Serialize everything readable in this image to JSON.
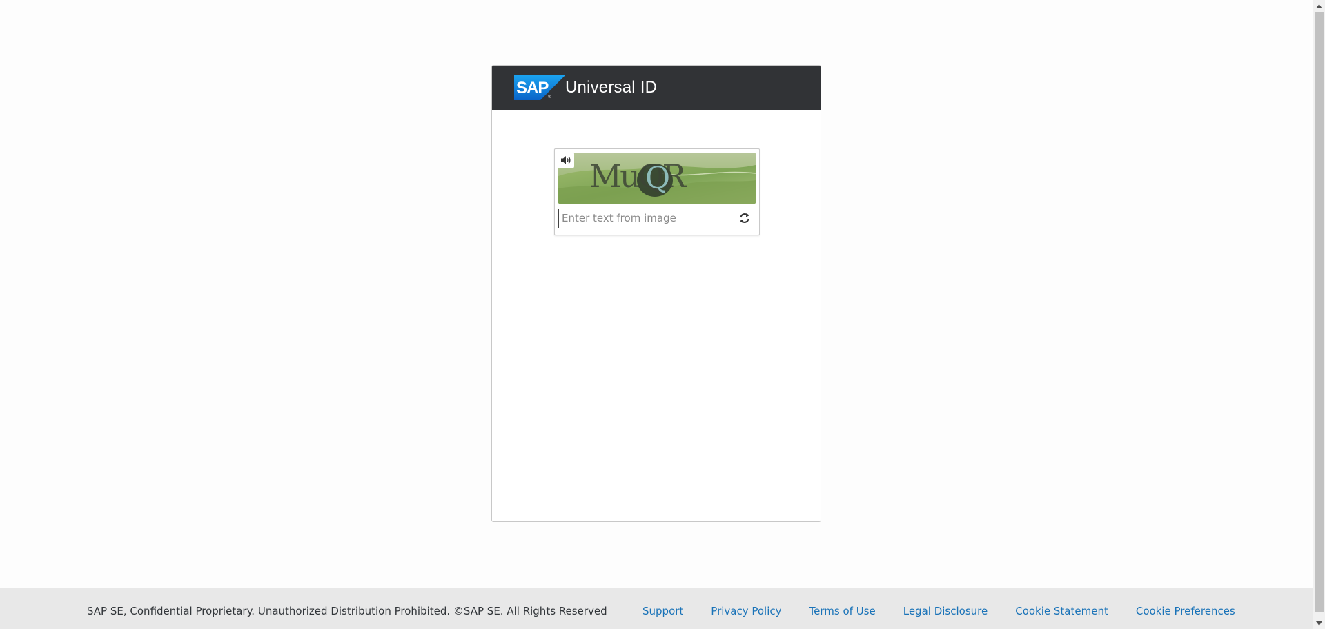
{
  "header": {
    "logo_text": "SAP",
    "title": "Universal ID",
    "background_color": "#313336",
    "logo_color": "#1a73e8"
  },
  "captcha": {
    "audio_icon": "speaker-icon",
    "image_text": "MuQR",
    "input_placeholder": "Enter text from image",
    "input_value": "",
    "refresh_icon": "refresh-icon"
  },
  "footer": {
    "copyright": "SAP SE, Confidential Proprietary. Unauthorized Distribution Prohibited. ©SAP SE. All Rights Reserved",
    "links": [
      {
        "label": "Support"
      },
      {
        "label": "Privacy Policy"
      },
      {
        "label": "Terms of Use"
      },
      {
        "label": "Legal Disclosure"
      },
      {
        "label": "Cookie Statement"
      },
      {
        "label": "Cookie Preferences"
      }
    ],
    "link_color": "#1a73b8",
    "background_color": "#e8e8e8"
  }
}
